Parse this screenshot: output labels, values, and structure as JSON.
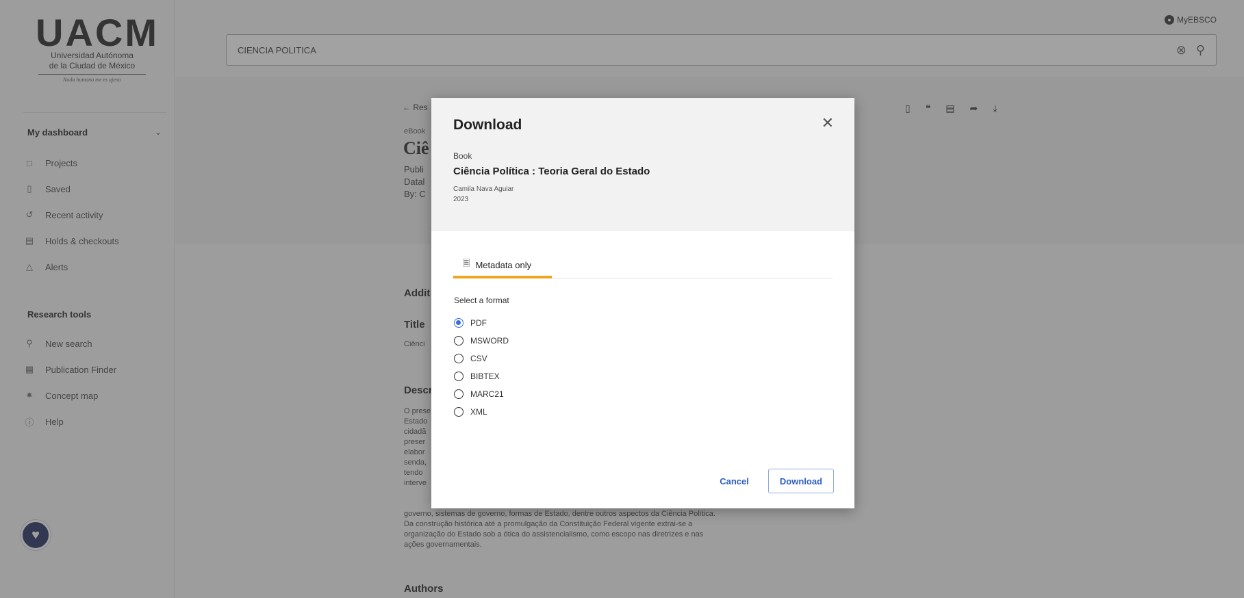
{
  "logo": {
    "mark": "UACM",
    "line1": "Universidad Autónoma",
    "line2": "de la Ciudad de México",
    "motto": "Nada humano me es ajeno"
  },
  "sidebar": {
    "dashboard_heading": "My dashboard",
    "dashboard_items": [
      {
        "label": "Projects",
        "icon": "projects-icon"
      },
      {
        "label": "Saved",
        "icon": "bookmark-icon"
      },
      {
        "label": "Recent activity",
        "icon": "history-icon"
      },
      {
        "label": "Holds & checkouts",
        "icon": "books-icon"
      },
      {
        "label": "Alerts",
        "icon": "bell-icon"
      }
    ],
    "tools_heading": "Research tools",
    "tools_items": [
      {
        "label": "New search",
        "icon": "search-icon"
      },
      {
        "label": "Publication Finder",
        "icon": "publication-icon"
      },
      {
        "label": "Concept map",
        "icon": "concept-map-icon"
      },
      {
        "label": "Help",
        "icon": "help-icon"
      }
    ]
  },
  "header": {
    "myebsco_label": "MyEBSCO",
    "search_query": "CIENCIA POLITICA"
  },
  "record": {
    "back_label": "Res",
    "type": "eBook",
    "title": "Ciê",
    "published": "Publi",
    "database": "Datal",
    "by": "By: C",
    "section_additional": "Addit",
    "section_title": "Title",
    "title_text": "Ciênci",
    "section_description": "Descr",
    "description_fragments": [
      "O prese",
      "Estado",
      "cidadã",
      "preser",
      "elabor",
      "senda,",
      "tendo",
      "interve"
    ],
    "description_visible": [
      "governo, sistemas de governo, formas de Estado, dentre outros aspectos da Ciência Política.",
      "Da construção histórica até a promulgação da Constituição Federal vigente extrai-se a",
      "organização do Estado sob a ótica do assistencialismo, como escopo nas diretrizes e nas",
      "ações governamentais."
    ],
    "section_authors": "Authors"
  },
  "modal": {
    "title": "Download",
    "item_type": "Book",
    "item_title": "Ciência Política : Teoria Geral do Estado",
    "item_author": "Camila Nava Aguiar",
    "item_year": "2023",
    "tab_label": "Metadata only",
    "format_label": "Select a format",
    "formats": [
      {
        "label": "PDF",
        "selected": true
      },
      {
        "label": "MSWORD",
        "selected": false
      },
      {
        "label": "CSV",
        "selected": false
      },
      {
        "label": "BIBTEX",
        "selected": false
      },
      {
        "label": "MARC21",
        "selected": false
      },
      {
        "label": "XML",
        "selected": false
      }
    ],
    "cancel_label": "Cancel",
    "download_label": "Download"
  },
  "colors": {
    "accent_tab": "#f0a51e",
    "link_blue": "#2c5fc4",
    "radio_blue": "#3b6fd4"
  }
}
